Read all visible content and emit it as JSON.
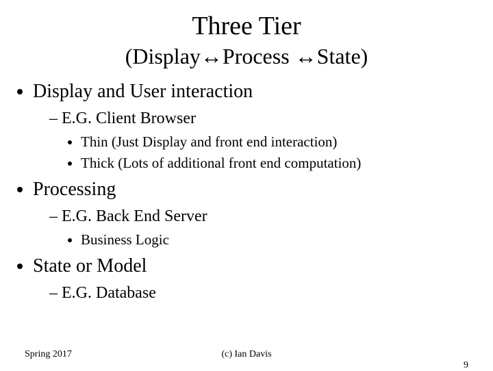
{
  "title": "Three Tier",
  "subtitle": "(Display↔Process ↔State)",
  "bullets": {
    "b1": "Display and User interaction",
    "b1_1": "E.G. Client Browser",
    "b1_1_1": "Thin (Just Display and front end interaction)",
    "b1_1_2": "Thick (Lots of additional front end computation)",
    "b2": "Processing",
    "b2_1": "E.G. Back End Server",
    "b2_1_1": "Business Logic",
    "b3": "State or Model",
    "b3_1": "E.G. Database"
  },
  "footer": {
    "left": "Spring 2017",
    "center": "(c) Ian Davis",
    "right": "9"
  }
}
